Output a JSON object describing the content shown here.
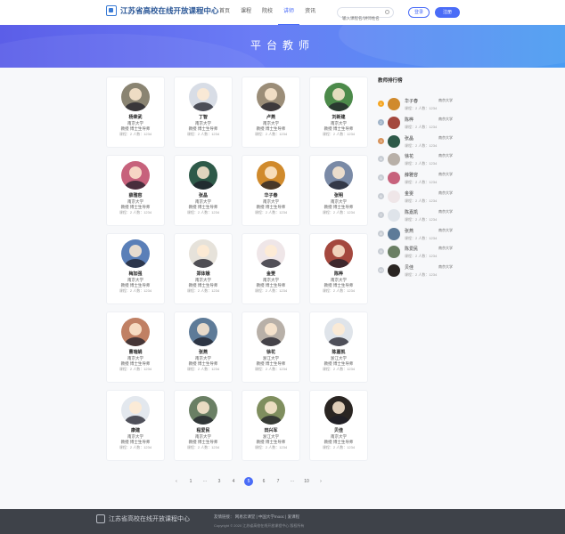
{
  "header": {
    "logo_text": "江苏省高校在线开放课程中心",
    "nav": [
      "首页",
      "课程",
      "院校",
      "讲师",
      "资讯"
    ],
    "active_nav_index": 3,
    "search_placeholder": "输入课程名/讲师姓名",
    "login_label": "登录",
    "register_label": "注册"
  },
  "banner": {
    "title": "平台教师"
  },
  "teachers": [
    {
      "name": "杨荣武",
      "school": "南京大学",
      "title": "教授  博士生导师",
      "stats": "课程：2   人数：1234",
      "tone": "#8a8472"
    },
    {
      "name": "丁智",
      "school": "南京大学",
      "title": "教授  博士生导师",
      "stats": "课程：2   人数：1234",
      "tone": "#d8dde6"
    },
    {
      "name": "卢燕",
      "school": "南京大学",
      "title": "教授  博士生导师",
      "stats": "课程：2   人数：1234",
      "tone": "#9b8d78"
    },
    {
      "name": "刘新建",
      "school": "南京大学",
      "title": "教授  博士生导师",
      "stats": "课程：2   人数：1234",
      "tone": "#4c8a4a"
    },
    {
      "name": "薛雅容",
      "school": "南京大学",
      "title": "教授  博士生导师",
      "stats": "课程：2   人数：1234",
      "tone": "#c7627c"
    },
    {
      "name": "张晶",
      "school": "南京大学",
      "title": "教授  博士生导师",
      "stats": "课程：2   人数：1234",
      "tone": "#2e5a49"
    },
    {
      "name": "华子春",
      "school": "南京大学",
      "title": "教授  博士生导师",
      "stats": "课程：2   人数：1234",
      "tone": "#d08a2c"
    },
    {
      "name": "张明",
      "school": "南京大学",
      "title": "教授  博士生导师",
      "stats": "课程：2   人数：1234",
      "tone": "#7a8aa6"
    },
    {
      "name": "梅加强",
      "school": "南京大学",
      "title": "教授  博士生导师",
      "stats": "课程：2   人数：1234",
      "tone": "#5a7fb8"
    },
    {
      "name": "郑体娥",
      "school": "南京大学",
      "title": "教授  博士生导师",
      "stats": "课程：2   人数：1234",
      "tone": "#e6e2da"
    },
    {
      "name": "金雯",
      "school": "南京大学",
      "title": "教授  博士生导师",
      "stats": "课程：2   人数：1234",
      "tone": "#efe6e8"
    },
    {
      "name": "陈桦",
      "school": "南京大学",
      "title": "教授  博士生导师",
      "stats": "课程：2   人数：1234",
      "tone": "#a4483e"
    },
    {
      "name": "曹瑞娟",
      "school": "南京大学",
      "title": "教授  博士生导师",
      "stats": "课程：2   人数：1234",
      "tone": "#c08064"
    },
    {
      "name": "张燕",
      "school": "南京大学",
      "title": "教授  博士生导师",
      "stats": "课程：2   人数：1234",
      "tone": "#5e7b98"
    },
    {
      "name": "徐花",
      "school": "浙江大学",
      "title": "教授  博士生导师",
      "stats": "课程：2   人数：1234",
      "tone": "#b8b0a8"
    },
    {
      "name": "陈嘉凯",
      "school": "浙江大学",
      "title": "教授  博士生导师",
      "stats": "课程：2   人数：1234",
      "tone": "#dfe4ea"
    },
    {
      "name": "康建",
      "school": "南京大学",
      "title": "教授  博士生导师",
      "stats": "课程：2   人数：1234",
      "tone": "#e3e8ee"
    },
    {
      "name": "程爱民",
      "school": "南京大学",
      "title": "教授  博士生导师",
      "stats": "课程：2   人数：1234",
      "tone": "#6a7f64"
    },
    {
      "name": "田兴军",
      "school": "浙江大学",
      "title": "教授  博士生导师",
      "stats": "课程：2   人数：1234",
      "tone": "#7f8e5e"
    },
    {
      "name": "贝佳",
      "school": "南京大学",
      "title": "教授  博士生导师",
      "stats": "课程：2   人数：1234",
      "tone": "#2a2522"
    }
  ],
  "ranking": {
    "title": "教师排行榜",
    "items": [
      {
        "rank": "1",
        "name": "华子春",
        "school": "南京大学",
        "stats": "课程：2   人数：1234",
        "badge": "#f5a623",
        "tone": "#d08a2c"
      },
      {
        "rank": "2",
        "name": "陈桦",
        "school": "南京大学",
        "stats": "课程：2   人数：1234",
        "badge": "#9fb3c8",
        "tone": "#a4483e"
      },
      {
        "rank": "3",
        "name": "张晶",
        "school": "南京大学",
        "stats": "课程：2   人数：1234",
        "badge": "#d7925a",
        "tone": "#2e5a49"
      },
      {
        "rank": "4",
        "name": "徐花",
        "school": "南京大学",
        "stats": "课程：2   人数：1234",
        "badge": "#c8cdd4",
        "tone": "#b8b0a8"
      },
      {
        "rank": "5",
        "name": "薛雅容",
        "school": "南京大学",
        "stats": "课程：2   人数：1234",
        "badge": "#c8cdd4",
        "tone": "#c7627c"
      },
      {
        "rank": "6",
        "name": "金雯",
        "school": "南京大学",
        "stats": "课程：2   人数：1234",
        "badge": "#c8cdd4",
        "tone": "#efe6e8"
      },
      {
        "rank": "7",
        "name": "陈嘉凯",
        "school": "南京大学",
        "stats": "课程：2   人数：1234",
        "badge": "#c8cdd4",
        "tone": "#dfe4ea"
      },
      {
        "rank": "8",
        "name": "张燕",
        "school": "南京大学",
        "stats": "课程：2   人数：1234",
        "badge": "#c8cdd4",
        "tone": "#5e7b98"
      },
      {
        "rank": "9",
        "name": "陈爱民",
        "school": "南京大学",
        "stats": "课程：2   人数：1234",
        "badge": "#c8cdd4",
        "tone": "#6a7f64"
      },
      {
        "rank": "10",
        "name": "贝佳",
        "school": "南京大学",
        "stats": "课程：2   人数：1234",
        "badge": "#c8cdd4",
        "tone": "#2a2522"
      }
    ]
  },
  "pagination": {
    "items": [
      "‹",
      "1",
      "···",
      "3",
      "4",
      "5",
      "6",
      "7",
      "···",
      "10",
      "›"
    ],
    "active": "5"
  },
  "footer": {
    "logo_text": "江苏省高校在线开放课程中心",
    "links": "友情链接：  网易云课堂  |  中国大学mooc  |  爱课程",
    "copyright": "Copyright © 2020  江苏省高校在线开放课程中心  版权所有"
  },
  "colors": {
    "accent": "#4a6cf7",
    "footer_bg": "#3e4249"
  }
}
